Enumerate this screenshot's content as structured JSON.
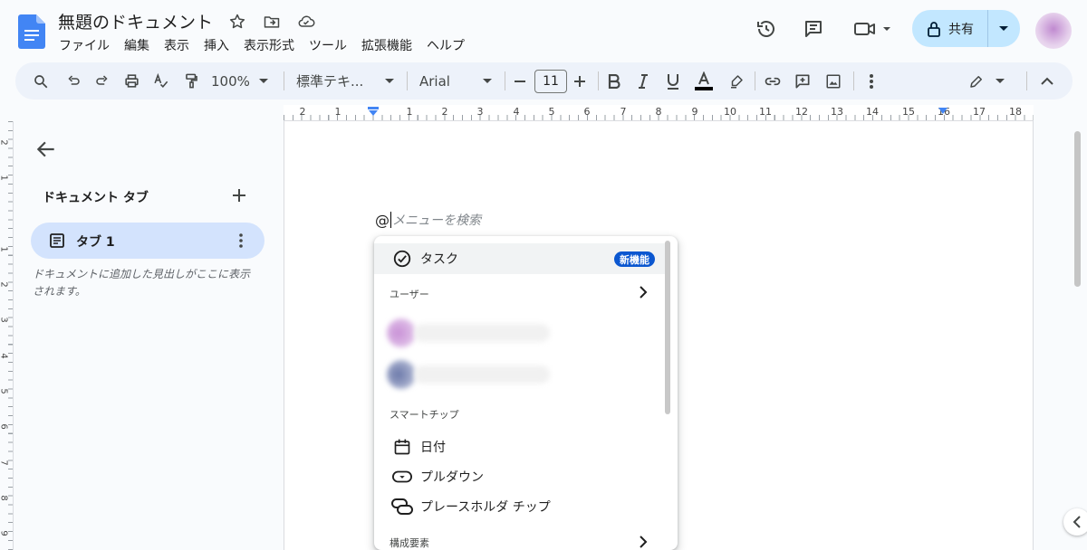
{
  "app": {
    "doc_title": "無題のドキュメント"
  },
  "menu": [
    "ファイル",
    "編集",
    "表示",
    "挿入",
    "表示形式",
    "ツール",
    "拡張機能",
    "ヘルプ"
  ],
  "header": {
    "share_label": "共有"
  },
  "toolbar": {
    "zoom": "100%",
    "style": "標準テキ...",
    "font": "Arial",
    "font_size": "11"
  },
  "ruler": {
    "h_labels": [
      "2",
      "1",
      "1",
      "1",
      "2",
      "3",
      "4",
      "5",
      "6",
      "7",
      "8",
      "9",
      "10",
      "11",
      "12",
      "13",
      "14",
      "15",
      "16",
      "17",
      "18"
    ],
    "v_labels": [
      "2",
      "1",
      "1",
      "1",
      "2",
      "3",
      "4",
      "5",
      "6",
      "7",
      "8",
      "9"
    ]
  },
  "sidebar": {
    "tabs_title": "ドキュメント タブ",
    "tab_label": "タブ 1",
    "hint": "ドキュメントに追加した見出しがここに表示されます。"
  },
  "editor": {
    "at_symbol": "@",
    "placeholder": "メニューを検索"
  },
  "at_menu": {
    "task_label": "タスク",
    "new_badge": "新機能",
    "users_section": "ユーザー",
    "smartchips_section": "スマートチップ",
    "items": {
      "date": "日付",
      "dropdown": "プルダウン",
      "placeholder_chip": "プレースホルダ チップ"
    },
    "building_blocks_section": "構成要素"
  },
  "colors": {
    "accent": "#0b57d0",
    "share_bg": "#c2e7ff",
    "tab_selected_bg": "#d3e3fd",
    "toolbar_bg": "#edf2fa"
  }
}
